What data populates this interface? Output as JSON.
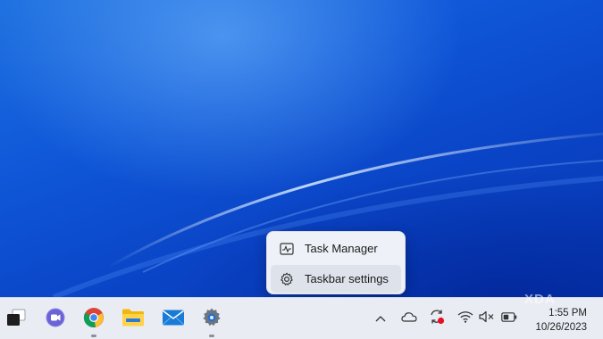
{
  "context_menu": {
    "items": [
      {
        "label": "Task Manager",
        "icon": "task-manager-icon"
      },
      {
        "label": "Taskbar settings",
        "icon": "gear-icon"
      }
    ]
  },
  "taskbar": {
    "apps": [
      {
        "name": "task-view",
        "icon": "task-view-icon",
        "running": false
      },
      {
        "name": "teams-chat",
        "icon": "teams-chat-icon",
        "running": false
      },
      {
        "name": "chrome",
        "icon": "chrome-icon",
        "running": true
      },
      {
        "name": "file-explorer",
        "icon": "folder-icon",
        "running": false
      },
      {
        "name": "mail",
        "icon": "mail-icon",
        "running": false
      },
      {
        "name": "settings",
        "icon": "settings-icon",
        "running": true
      }
    ],
    "tray": {
      "icons": [
        "chevron-up-icon",
        "onedrive-icon",
        "sync-icon",
        "wifi-icon",
        "volume-muted-icon",
        "battery-icon"
      ],
      "time": "1:55 PM",
      "date": "10/26/2023"
    }
  },
  "watermark": "XDA",
  "colors": {
    "accent": "#0a44c6",
    "taskbar": "#e9ecf3",
    "menu": "#eef1f7"
  }
}
